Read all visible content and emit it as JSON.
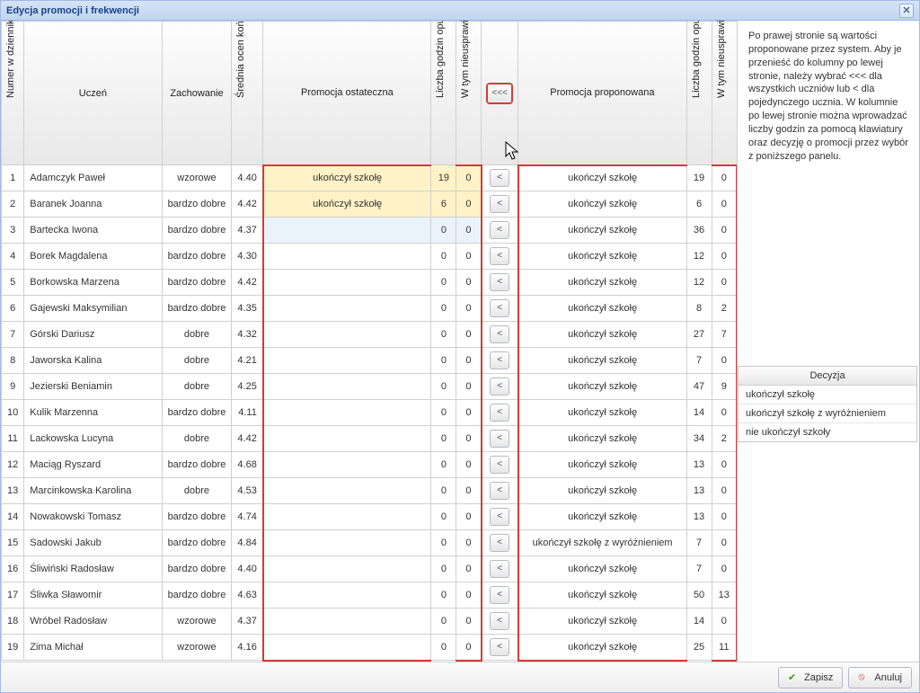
{
  "window": {
    "title": "Edycja promocji i frekwencji",
    "close_tooltip": "Zamknij"
  },
  "columns": {
    "numer": "Numer w dzienniku",
    "uczen": "Uczeń",
    "zachowanie": "Zachowanie",
    "srednia": "Średnia ocen końcowych",
    "promocja_ost": "Promocja ostateczna",
    "lgo": "Liczba godzin opuszczonych",
    "wtn": "W tym nieusprawiedliwionych",
    "all_arrow": "<<<",
    "promocja_prop": "Promocja proponowana",
    "lgo2": "Liczba godzin opuszczonych",
    "wtn2": "W tym nieusprawiedliwionych"
  },
  "rows": [
    {
      "n": 1,
      "name": "Adamczyk Paweł",
      "zach": "wzorowe",
      "avg": "4.40",
      "finaldec": "ukończył szkołę",
      "flg": "19",
      "fwt": "0",
      "prop": "ukończył szkołę",
      "plg": "19",
      "pwt": "0",
      "hl": true
    },
    {
      "n": 2,
      "name": "Baranek Joanna",
      "zach": "bardzo dobre",
      "avg": "4.42",
      "finaldec": "ukończył szkołę",
      "flg": "6",
      "fwt": "0",
      "prop": "ukończył szkołę",
      "plg": "6",
      "pwt": "0",
      "hl": true
    },
    {
      "n": 3,
      "name": "Bartecka Iwona",
      "zach": "bardzo dobre",
      "avg": "4.37",
      "finaldec": "",
      "flg": "0",
      "fwt": "0",
      "prop": "ukończył szkołę",
      "plg": "36",
      "pwt": "0",
      "sel": true
    },
    {
      "n": 4,
      "name": "Borek Magdalena",
      "zach": "bardzo dobre",
      "avg": "4.30",
      "finaldec": "",
      "flg": "0",
      "fwt": "0",
      "prop": "ukończył szkołę",
      "plg": "12",
      "pwt": "0"
    },
    {
      "n": 5,
      "name": "Borkowska Marzena",
      "zach": "bardzo dobre",
      "avg": "4.42",
      "finaldec": "",
      "flg": "0",
      "fwt": "0",
      "prop": "ukończył szkołę",
      "plg": "12",
      "pwt": "0"
    },
    {
      "n": 6,
      "name": "Gajewski Maksymilian",
      "zach": "bardzo dobre",
      "avg": "4.35",
      "finaldec": "",
      "flg": "0",
      "fwt": "0",
      "prop": "ukończył szkołę",
      "plg": "8",
      "pwt": "2"
    },
    {
      "n": 7,
      "name": "Górski Dariusz",
      "zach": "dobre",
      "avg": "4.32",
      "finaldec": "",
      "flg": "0",
      "fwt": "0",
      "prop": "ukończył szkołę",
      "plg": "27",
      "pwt": "7"
    },
    {
      "n": 8,
      "name": "Jaworska Kalina",
      "zach": "dobre",
      "avg": "4.21",
      "finaldec": "",
      "flg": "0",
      "fwt": "0",
      "prop": "ukończył szkołę",
      "plg": "7",
      "pwt": "0"
    },
    {
      "n": 9,
      "name": "Jezierski Beniamin",
      "zach": "dobre",
      "avg": "4.25",
      "finaldec": "",
      "flg": "0",
      "fwt": "0",
      "prop": "ukończył szkołę",
      "plg": "47",
      "pwt": "9"
    },
    {
      "n": 10,
      "name": "Kulik Marzenna",
      "zach": "bardzo dobre",
      "avg": "4.11",
      "finaldec": "",
      "flg": "0",
      "fwt": "0",
      "prop": "ukończył szkołę",
      "plg": "14",
      "pwt": "0"
    },
    {
      "n": 11,
      "name": "Lackowska Lucyna",
      "zach": "dobre",
      "avg": "4.42",
      "finaldec": "",
      "flg": "0",
      "fwt": "0",
      "prop": "ukończył szkołę",
      "plg": "34",
      "pwt": "2"
    },
    {
      "n": 12,
      "name": "Maciąg Ryszard",
      "zach": "bardzo dobre",
      "avg": "4.68",
      "finaldec": "",
      "flg": "0",
      "fwt": "0",
      "prop": "ukończył szkołę",
      "plg": "13",
      "pwt": "0"
    },
    {
      "n": 13,
      "name": "Marcinkowska Karolina",
      "zach": "dobre",
      "avg": "4.53",
      "finaldec": "",
      "flg": "0",
      "fwt": "0",
      "prop": "ukończył szkołę",
      "plg": "13",
      "pwt": "0"
    },
    {
      "n": 14,
      "name": "Nowakowski Tomasz",
      "zach": "bardzo dobre",
      "avg": "4.74",
      "finaldec": "",
      "flg": "0",
      "fwt": "0",
      "prop": "ukończył szkołę",
      "plg": "13",
      "pwt": "0"
    },
    {
      "n": 15,
      "name": "Sadowski Jakub",
      "zach": "bardzo dobre",
      "avg": "4.84",
      "finaldec": "",
      "flg": "0",
      "fwt": "0",
      "prop": "ukończył szkołę z wyróżnieniem",
      "plg": "7",
      "pwt": "0"
    },
    {
      "n": 16,
      "name": "Śliwiński Radosław",
      "zach": "bardzo dobre",
      "avg": "4.40",
      "finaldec": "",
      "flg": "0",
      "fwt": "0",
      "prop": "ukończył szkołę",
      "plg": "7",
      "pwt": "0"
    },
    {
      "n": 17,
      "name": "Śliwka Sławomir",
      "zach": "bardzo dobre",
      "avg": "4.63",
      "finaldec": "",
      "flg": "0",
      "fwt": "0",
      "prop": "ukończył szkołę",
      "plg": "50",
      "pwt": "13"
    },
    {
      "n": 18,
      "name": "Wróbel Radosław",
      "zach": "wzorowe",
      "avg": "4.37",
      "finaldec": "",
      "flg": "0",
      "fwt": "0",
      "prop": "ukończył szkołę",
      "plg": "14",
      "pwt": "0"
    },
    {
      "n": 19,
      "name": "Zima Michał",
      "zach": "wzorowe",
      "avg": "4.16",
      "finaldec": "",
      "flg": "0",
      "fwt": "0",
      "prop": "ukończył szkołę",
      "plg": "25",
      "pwt": "11"
    }
  ],
  "row_arrow": "<",
  "info_text": "Po prawej stronie są wartości proponowane przez system. Aby je przenieść do kolumny po lewej stronie, należy wybrać <<< dla wszystkich uczniów lub < dla pojedynczego ucznia. W kolumnie po lewej stronie można wprowadzać liczby godzin za pomocą klawiatury oraz decyzję o promocji przez wybór z poniższego panelu.",
  "decision": {
    "header": "Decyzja",
    "options": [
      "ukończył szkołę",
      "ukończył szkołę z wyróżnieniem",
      "nie ukończył szkoły"
    ]
  },
  "footer": {
    "save": "Zapisz",
    "cancel": "Anuluj"
  }
}
